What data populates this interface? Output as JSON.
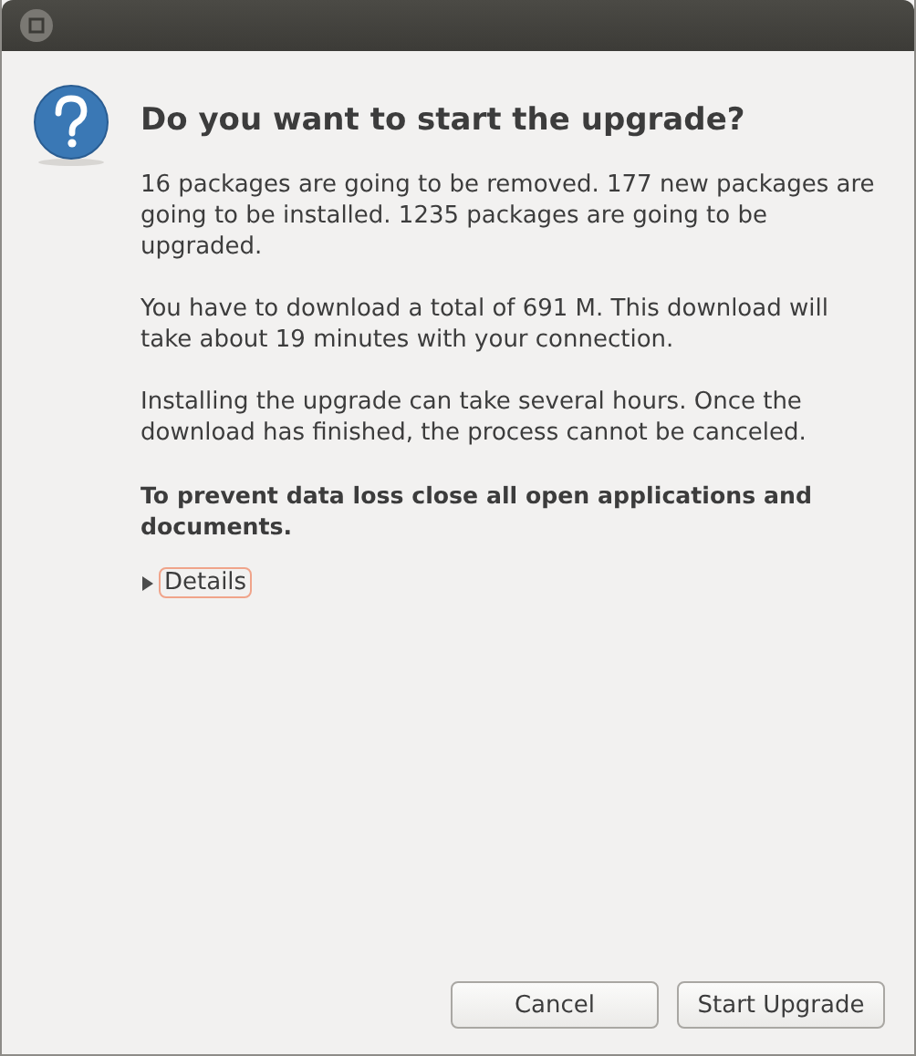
{
  "dialog": {
    "heading": "Do you want to start the upgrade?",
    "paragraphs": [
      {
        "text": "16 packages are going to be removed. 177 new packages are going to be installed. 1235 packages are going to be upgraded.",
        "bold": false
      },
      {
        "text": "You have to download a total of 691 M. This download will take about 19 minutes with your connection.",
        "bold": false
      },
      {
        "text": "Installing the upgrade can take several hours. Once the download has finished, the process cannot be canceled.",
        "bold": false
      },
      {
        "text": "To prevent data loss close all open applications and documents.",
        "bold": true
      }
    ],
    "details": {
      "label": "Details",
      "expanded": false
    },
    "buttons": [
      "Cancel",
      "Start Upgrade"
    ]
  }
}
